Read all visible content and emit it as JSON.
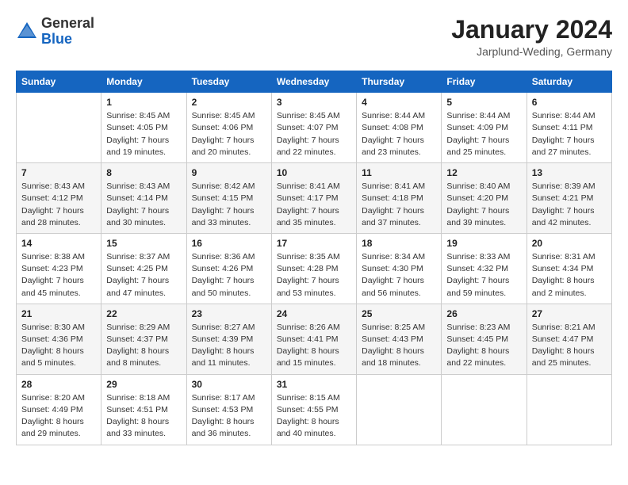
{
  "header": {
    "logo_general": "General",
    "logo_blue": "Blue",
    "month_year": "January 2024",
    "location": "Jarplund-Weding, Germany"
  },
  "weekdays": [
    "Sunday",
    "Monday",
    "Tuesday",
    "Wednesday",
    "Thursday",
    "Friday",
    "Saturday"
  ],
  "weeks": [
    [
      {
        "day": "",
        "sunrise": "",
        "sunset": "",
        "daylight": ""
      },
      {
        "day": "1",
        "sunrise": "Sunrise: 8:45 AM",
        "sunset": "Sunset: 4:05 PM",
        "daylight": "Daylight: 7 hours and 19 minutes."
      },
      {
        "day": "2",
        "sunrise": "Sunrise: 8:45 AM",
        "sunset": "Sunset: 4:06 PM",
        "daylight": "Daylight: 7 hours and 20 minutes."
      },
      {
        "day": "3",
        "sunrise": "Sunrise: 8:45 AM",
        "sunset": "Sunset: 4:07 PM",
        "daylight": "Daylight: 7 hours and 22 minutes."
      },
      {
        "day": "4",
        "sunrise": "Sunrise: 8:44 AM",
        "sunset": "Sunset: 4:08 PM",
        "daylight": "Daylight: 7 hours and 23 minutes."
      },
      {
        "day": "5",
        "sunrise": "Sunrise: 8:44 AM",
        "sunset": "Sunset: 4:09 PM",
        "daylight": "Daylight: 7 hours and 25 minutes."
      },
      {
        "day": "6",
        "sunrise": "Sunrise: 8:44 AM",
        "sunset": "Sunset: 4:11 PM",
        "daylight": "Daylight: 7 hours and 27 minutes."
      }
    ],
    [
      {
        "day": "7",
        "sunrise": "Sunrise: 8:43 AM",
        "sunset": "Sunset: 4:12 PM",
        "daylight": "Daylight: 7 hours and 28 minutes."
      },
      {
        "day": "8",
        "sunrise": "Sunrise: 8:43 AM",
        "sunset": "Sunset: 4:14 PM",
        "daylight": "Daylight: 7 hours and 30 minutes."
      },
      {
        "day": "9",
        "sunrise": "Sunrise: 8:42 AM",
        "sunset": "Sunset: 4:15 PM",
        "daylight": "Daylight: 7 hours and 33 minutes."
      },
      {
        "day": "10",
        "sunrise": "Sunrise: 8:41 AM",
        "sunset": "Sunset: 4:17 PM",
        "daylight": "Daylight: 7 hours and 35 minutes."
      },
      {
        "day": "11",
        "sunrise": "Sunrise: 8:41 AM",
        "sunset": "Sunset: 4:18 PM",
        "daylight": "Daylight: 7 hours and 37 minutes."
      },
      {
        "day": "12",
        "sunrise": "Sunrise: 8:40 AM",
        "sunset": "Sunset: 4:20 PM",
        "daylight": "Daylight: 7 hours and 39 minutes."
      },
      {
        "day": "13",
        "sunrise": "Sunrise: 8:39 AM",
        "sunset": "Sunset: 4:21 PM",
        "daylight": "Daylight: 7 hours and 42 minutes."
      }
    ],
    [
      {
        "day": "14",
        "sunrise": "Sunrise: 8:38 AM",
        "sunset": "Sunset: 4:23 PM",
        "daylight": "Daylight: 7 hours and 45 minutes."
      },
      {
        "day": "15",
        "sunrise": "Sunrise: 8:37 AM",
        "sunset": "Sunset: 4:25 PM",
        "daylight": "Daylight: 7 hours and 47 minutes."
      },
      {
        "day": "16",
        "sunrise": "Sunrise: 8:36 AM",
        "sunset": "Sunset: 4:26 PM",
        "daylight": "Daylight: 7 hours and 50 minutes."
      },
      {
        "day": "17",
        "sunrise": "Sunrise: 8:35 AM",
        "sunset": "Sunset: 4:28 PM",
        "daylight": "Daylight: 7 hours and 53 minutes."
      },
      {
        "day": "18",
        "sunrise": "Sunrise: 8:34 AM",
        "sunset": "Sunset: 4:30 PM",
        "daylight": "Daylight: 7 hours and 56 minutes."
      },
      {
        "day": "19",
        "sunrise": "Sunrise: 8:33 AM",
        "sunset": "Sunset: 4:32 PM",
        "daylight": "Daylight: 7 hours and 59 minutes."
      },
      {
        "day": "20",
        "sunrise": "Sunrise: 8:31 AM",
        "sunset": "Sunset: 4:34 PM",
        "daylight": "Daylight: 8 hours and 2 minutes."
      }
    ],
    [
      {
        "day": "21",
        "sunrise": "Sunrise: 8:30 AM",
        "sunset": "Sunset: 4:36 PM",
        "daylight": "Daylight: 8 hours and 5 minutes."
      },
      {
        "day": "22",
        "sunrise": "Sunrise: 8:29 AM",
        "sunset": "Sunset: 4:37 PM",
        "daylight": "Daylight: 8 hours and 8 minutes."
      },
      {
        "day": "23",
        "sunrise": "Sunrise: 8:27 AM",
        "sunset": "Sunset: 4:39 PM",
        "daylight": "Daylight: 8 hours and 11 minutes."
      },
      {
        "day": "24",
        "sunrise": "Sunrise: 8:26 AM",
        "sunset": "Sunset: 4:41 PM",
        "daylight": "Daylight: 8 hours and 15 minutes."
      },
      {
        "day": "25",
        "sunrise": "Sunrise: 8:25 AM",
        "sunset": "Sunset: 4:43 PM",
        "daylight": "Daylight: 8 hours and 18 minutes."
      },
      {
        "day": "26",
        "sunrise": "Sunrise: 8:23 AM",
        "sunset": "Sunset: 4:45 PM",
        "daylight": "Daylight: 8 hours and 22 minutes."
      },
      {
        "day": "27",
        "sunrise": "Sunrise: 8:21 AM",
        "sunset": "Sunset: 4:47 PM",
        "daylight": "Daylight: 8 hours and 25 minutes."
      }
    ],
    [
      {
        "day": "28",
        "sunrise": "Sunrise: 8:20 AM",
        "sunset": "Sunset: 4:49 PM",
        "daylight": "Daylight: 8 hours and 29 minutes."
      },
      {
        "day": "29",
        "sunrise": "Sunrise: 8:18 AM",
        "sunset": "Sunset: 4:51 PM",
        "daylight": "Daylight: 8 hours and 33 minutes."
      },
      {
        "day": "30",
        "sunrise": "Sunrise: 8:17 AM",
        "sunset": "Sunset: 4:53 PM",
        "daylight": "Daylight: 8 hours and 36 minutes."
      },
      {
        "day": "31",
        "sunrise": "Sunrise: 8:15 AM",
        "sunset": "Sunset: 4:55 PM",
        "daylight": "Daylight: 8 hours and 40 minutes."
      },
      {
        "day": "",
        "sunrise": "",
        "sunset": "",
        "daylight": ""
      },
      {
        "day": "",
        "sunrise": "",
        "sunset": "",
        "daylight": ""
      },
      {
        "day": "",
        "sunrise": "",
        "sunset": "",
        "daylight": ""
      }
    ]
  ]
}
